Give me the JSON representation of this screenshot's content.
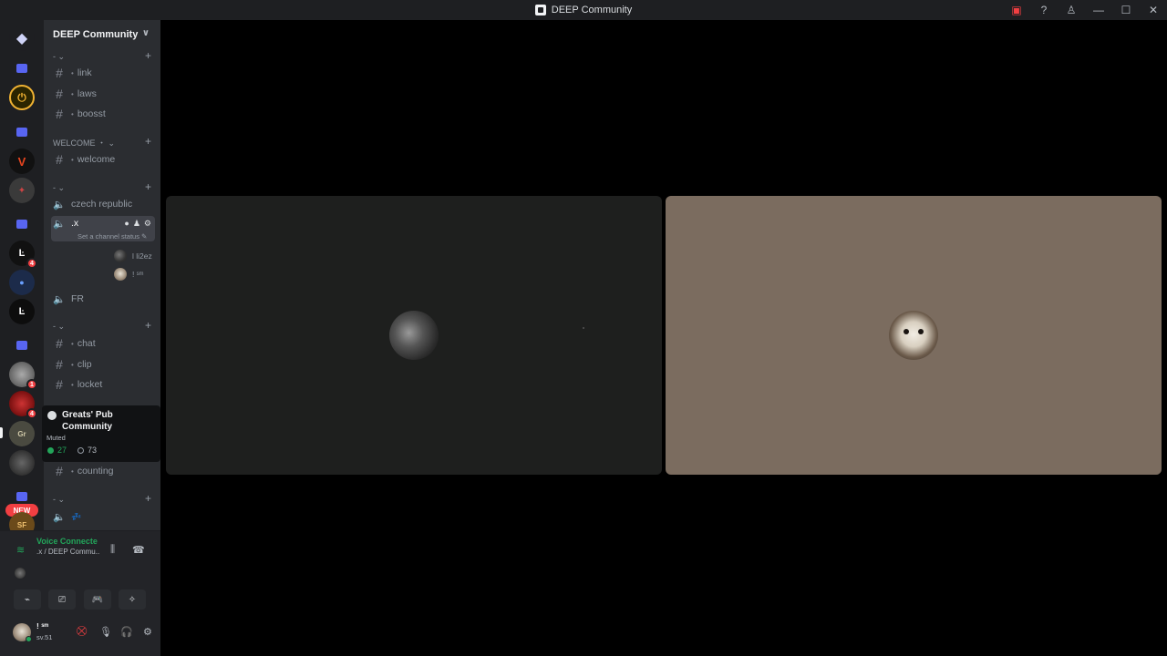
{
  "window": {
    "title": "DEEP Community",
    "buttons": {
      "inbox": "▣",
      "help": "?",
      "shop": "♙",
      "minimize": "—",
      "maximize": "☐",
      "close": "✕"
    }
  },
  "rail": {
    "home": "◆",
    "servers": [
      {
        "name": "server-gold",
        "glyph": "⏻",
        "color": "#2b2500",
        "badge": null
      },
      {
        "name": "server-v",
        "glyph": "V",
        "color": "#7a1a1a",
        "badge": null
      },
      {
        "name": "server-emblem",
        "glyph": "✦",
        "color": "#3a3a3a",
        "badge": null
      },
      {
        "name": "server-lv",
        "glyph": "Ŀ",
        "color": "#111",
        "badge": "4"
      },
      {
        "name": "server-blue",
        "glyph": "●",
        "color": "#1c2b4a",
        "badge": null
      },
      {
        "name": "server-k",
        "glyph": "Ŀ",
        "color": "#0d0d0d",
        "badge": null
      },
      {
        "name": "server-anime",
        "glyph": "",
        "color": "#5a5a5a",
        "badge": "1"
      },
      {
        "name": "server-red",
        "glyph": "",
        "color": "#8a1a1a",
        "badge": "4"
      },
      {
        "name": "server-greats",
        "glyph": "Gr",
        "color": "#4a4a40",
        "badge": null
      },
      {
        "name": "server-dark",
        "glyph": "",
        "color": "#2a2a2a",
        "badge": null
      },
      {
        "name": "server-sf",
        "glyph": "SF",
        "color": "#6b4a1a",
        "badge": null
      }
    ],
    "new_badge": "NEW"
  },
  "guild": {
    "name": "DEEP Community",
    "chevron": "∨"
  },
  "categories": {
    "c1": {
      "label": "- ⌄",
      "plus": "+"
    },
    "c2": {
      "label": "WELCOME ・ ⌄",
      "plus": "+"
    },
    "c3": {
      "label": "- ⌄",
      "plus": "+"
    },
    "c4": {
      "label": "- ⌄",
      "plus": "+"
    },
    "c5": {
      "label": "- ⌄",
      "plus": "+"
    }
  },
  "channels": {
    "link": "link",
    "laws": "laws",
    "boosst": "boosst",
    "welcome": "welcome",
    "czech": "czech republic",
    "x": ".x",
    "x_status": "Set a channel status ✎",
    "fr": "FR",
    "chat": "chat",
    "clip": "clip",
    "locket": "locket",
    "counting": "counting",
    "zzz": "💤"
  },
  "voice_users": [
    {
      "name": "l li2ez"
    },
    {
      "name": "! ˢᵐ"
    }
  ],
  "tooltip": {
    "name": "Greats' Pub Community",
    "muted": "Muted",
    "online": "27",
    "members": "73"
  },
  "voice": {
    "title": "Voice Connecte",
    "channel": ".x / DEEP Commu...",
    "actions": [
      "⌁",
      "⎚",
      "🎮",
      "✧"
    ]
  },
  "user": {
    "name": "! ˢᵐ",
    "tag": "sv.51"
  }
}
